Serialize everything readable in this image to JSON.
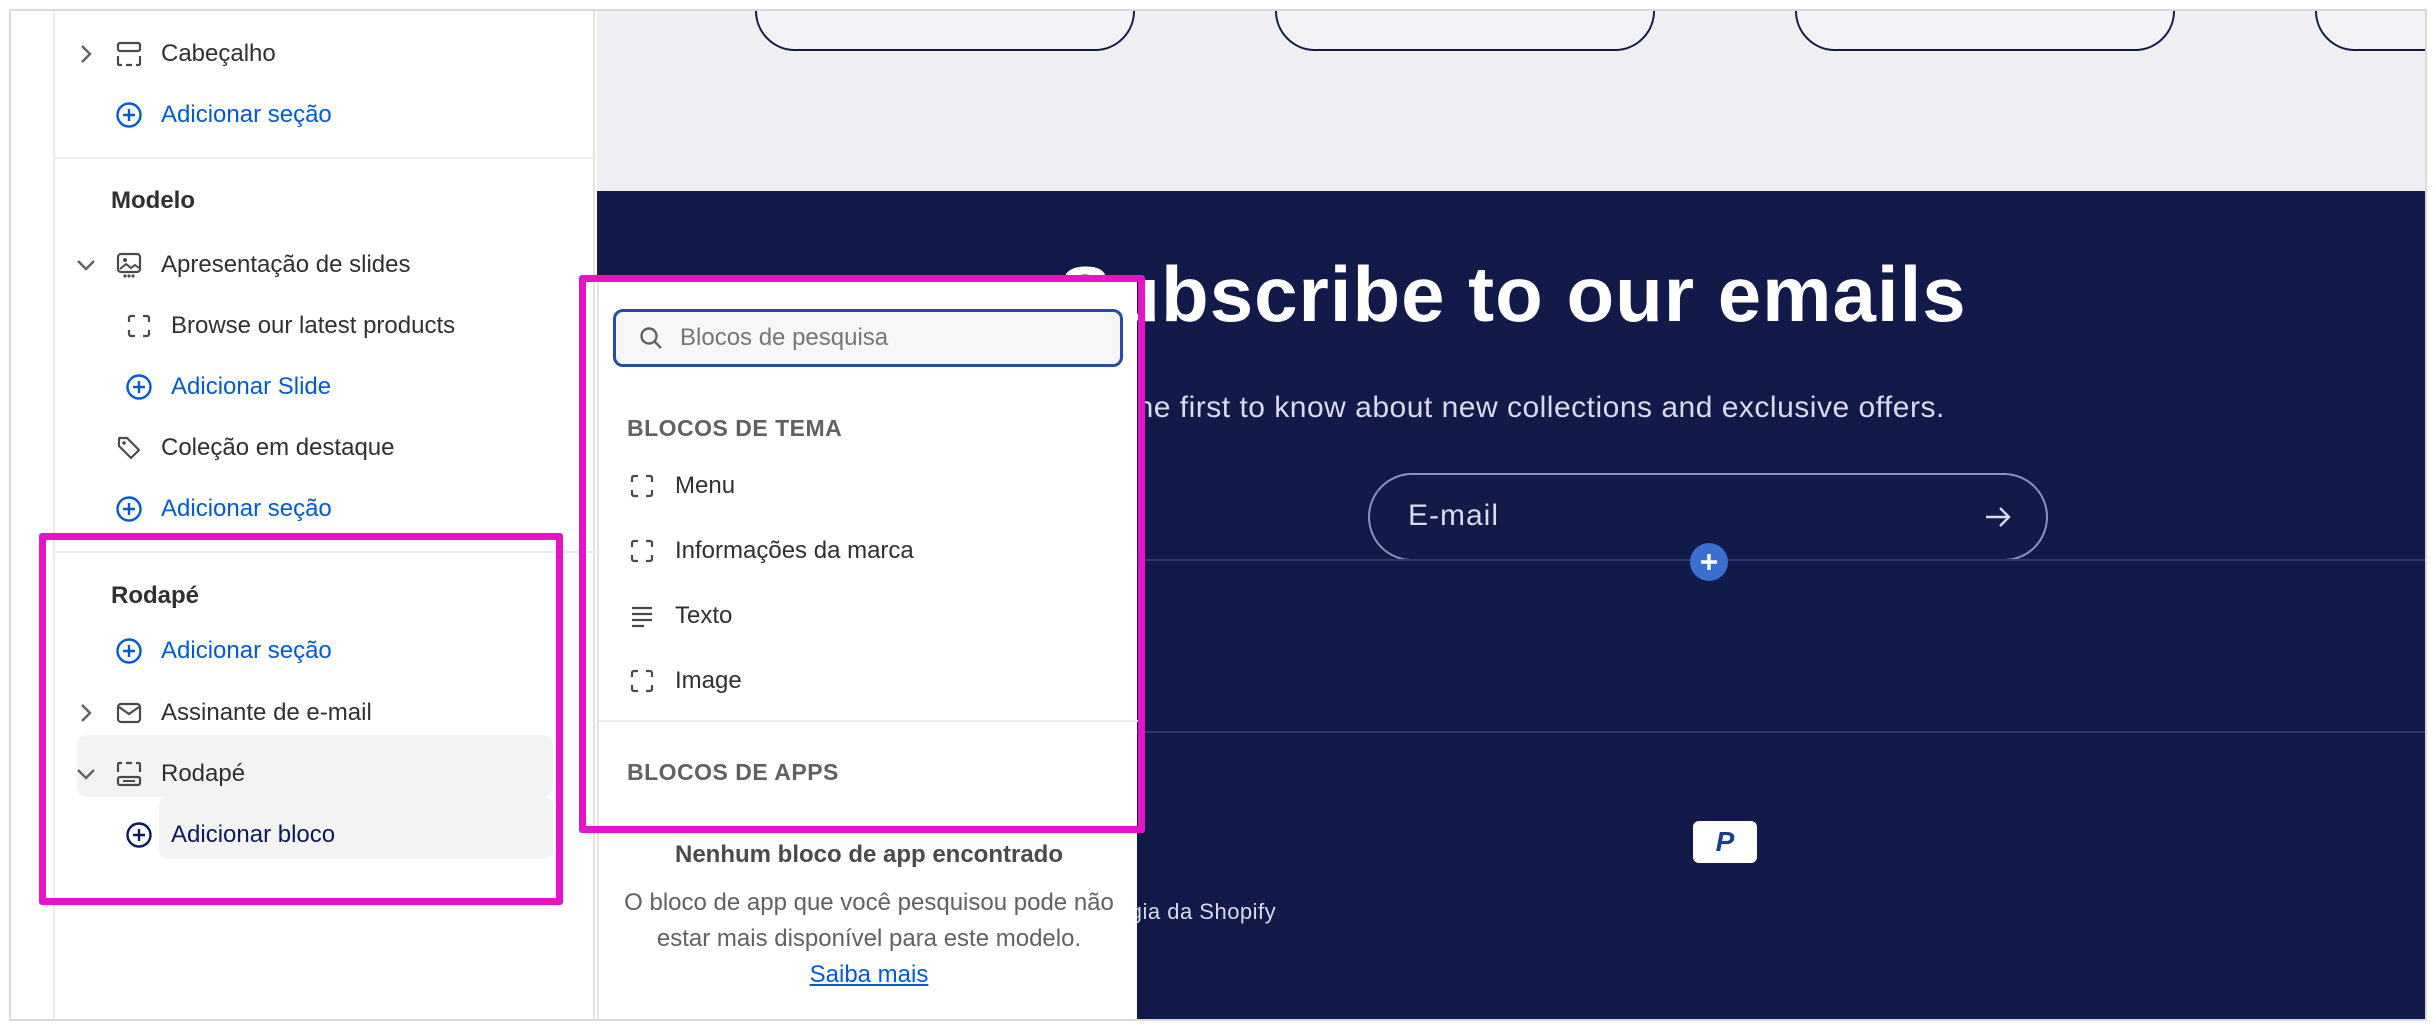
{
  "sidebar": {
    "header_item": "Cabeçalho",
    "add_section": "Adicionar seção",
    "template_title": "Modelo",
    "slideshow": "Apresentação de slides",
    "slide_item": "Browse our latest products",
    "add_slide": "Adicionar Slide",
    "featured_collection": "Coleção em destaque",
    "footer_title": "Rodapé",
    "email_signup": "Assinante de e-mail",
    "footer_item": "Rodapé",
    "add_block": "Adicionar bloco"
  },
  "popover": {
    "search_placeholder": "Blocos de pesquisa",
    "theme_blocks_heading": "BLOCOS DE TEMA",
    "theme_blocks": [
      "Menu",
      "Informações da marca",
      "Texto",
      "Image"
    ],
    "app_blocks_heading": "BLOCOS DE APPS",
    "empty_title": "Nenhum bloco de app encontrado",
    "empty_body": "O bloco de app que você pesquisou pode não estar mais disponível para este modelo.",
    "learn_more": "Saiba mais"
  },
  "preview": {
    "newsletter_title": "Subscribe to our emails",
    "newsletter_subtitle": "Be the first to know about new collections and exclusive offers.",
    "email_placeholder": "E-mail",
    "powered_by": "ogia da Shopify",
    "paypal_label": "P"
  },
  "colors": {
    "highlight": "#e514c8",
    "link": "#005bd3",
    "newsletter_bg": "#111a48"
  }
}
